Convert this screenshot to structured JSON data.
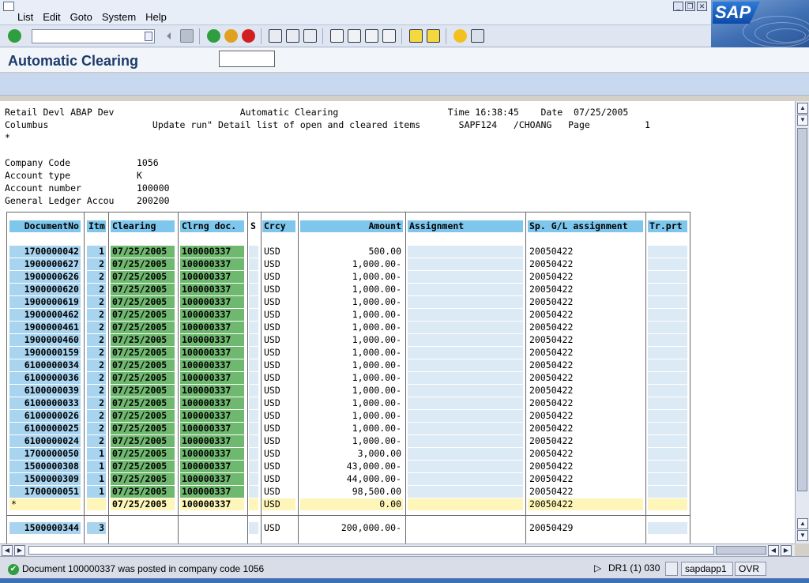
{
  "menu": {
    "items": [
      "List",
      "Edit",
      "Goto",
      "System",
      "Help"
    ]
  },
  "logo": {
    "text": "SAP"
  },
  "toolbar": {
    "command_field_value": ""
  },
  "title": "Automatic Clearing",
  "header": {
    "lines": [
      "Retail Devl ABAP Dev                       Automatic Clearing                    Time 16:38:45    Date  07/25/2005",
      "Columbus                   Update run\" Detail list of open and cleared items       SAPF124   /CHOANG   Page          1",
      "*"
    ],
    "fields": [
      {
        "label": "Company Code",
        "value": "1056"
      },
      {
        "label": "Account type",
        "value": "K"
      },
      {
        "label": "Account number",
        "value": "100000"
      },
      {
        "label": "General Ledger Accou",
        "value": "200200"
      }
    ]
  },
  "table": {
    "columns": [
      "DocumentNo",
      "Itm",
      "Clearing",
      "Clrng doc.",
      "S",
      "Crcy",
      "Amount",
      "Assignment",
      "Sp. G/L assignment",
      "Tr.prt"
    ],
    "rows": [
      {
        "doc": "1700000042",
        "itm": "1",
        "clearing": "07/25/2005",
        "clrng_doc": "100000337",
        "crcy": "USD",
        "amount": "500.00",
        "sp_gl": "20050422"
      },
      {
        "doc": "1900000627",
        "itm": "2",
        "clearing": "07/25/2005",
        "clrng_doc": "100000337",
        "crcy": "USD",
        "amount": "1,000.00-",
        "sp_gl": "20050422"
      },
      {
        "doc": "1900000626",
        "itm": "2",
        "clearing": "07/25/2005",
        "clrng_doc": "100000337",
        "crcy": "USD",
        "amount": "1,000.00-",
        "sp_gl": "20050422"
      },
      {
        "doc": "1900000620",
        "itm": "2",
        "clearing": "07/25/2005",
        "clrng_doc": "100000337",
        "crcy": "USD",
        "amount": "1,000.00-",
        "sp_gl": "20050422"
      },
      {
        "doc": "1900000619",
        "itm": "2",
        "clearing": "07/25/2005",
        "clrng_doc": "100000337",
        "crcy": "USD",
        "amount": "1,000.00-",
        "sp_gl": "20050422"
      },
      {
        "doc": "1900000462",
        "itm": "2",
        "clearing": "07/25/2005",
        "clrng_doc": "100000337",
        "crcy": "USD",
        "amount": "1,000.00-",
        "sp_gl": "20050422"
      },
      {
        "doc": "1900000461",
        "itm": "2",
        "clearing": "07/25/2005",
        "clrng_doc": "100000337",
        "crcy": "USD",
        "amount": "1,000.00-",
        "sp_gl": "20050422"
      },
      {
        "doc": "1900000460",
        "itm": "2",
        "clearing": "07/25/2005",
        "clrng_doc": "100000337",
        "crcy": "USD",
        "amount": "1,000.00-",
        "sp_gl": "20050422"
      },
      {
        "doc": "1900000159",
        "itm": "2",
        "clearing": "07/25/2005",
        "clrng_doc": "100000337",
        "crcy": "USD",
        "amount": "1,000.00-",
        "sp_gl": "20050422"
      },
      {
        "doc": "6100000034",
        "itm": "2",
        "clearing": "07/25/2005",
        "clrng_doc": "100000337",
        "crcy": "USD",
        "amount": "1,000.00-",
        "sp_gl": "20050422"
      },
      {
        "doc": "6100000036",
        "itm": "2",
        "clearing": "07/25/2005",
        "clrng_doc": "100000337",
        "crcy": "USD",
        "amount": "1,000.00-",
        "sp_gl": "20050422"
      },
      {
        "doc": "6100000039",
        "itm": "2",
        "clearing": "07/25/2005",
        "clrng_doc": "100000337",
        "crcy": "USD",
        "amount": "1,000.00-",
        "sp_gl": "20050422"
      },
      {
        "doc": "6100000033",
        "itm": "2",
        "clearing": "07/25/2005",
        "clrng_doc": "100000337",
        "crcy": "USD",
        "amount": "1,000.00-",
        "sp_gl": "20050422"
      },
      {
        "doc": "6100000026",
        "itm": "2",
        "clearing": "07/25/2005",
        "clrng_doc": "100000337",
        "crcy": "USD",
        "amount": "1,000.00-",
        "sp_gl": "20050422"
      },
      {
        "doc": "6100000025",
        "itm": "2",
        "clearing": "07/25/2005",
        "clrng_doc": "100000337",
        "crcy": "USD",
        "amount": "1,000.00-",
        "sp_gl": "20050422"
      },
      {
        "doc": "6100000024",
        "itm": "2",
        "clearing": "07/25/2005",
        "clrng_doc": "100000337",
        "crcy": "USD",
        "amount": "1,000.00-",
        "sp_gl": "20050422"
      },
      {
        "doc": "1700000050",
        "itm": "1",
        "clearing": "07/25/2005",
        "clrng_doc": "100000337",
        "crcy": "USD",
        "amount": "3,000.00",
        "sp_gl": "20050422"
      },
      {
        "doc": "1500000308",
        "itm": "1",
        "clearing": "07/25/2005",
        "clrng_doc": "100000337",
        "crcy": "USD",
        "amount": "43,000.00-",
        "sp_gl": "20050422"
      },
      {
        "doc": "1500000309",
        "itm": "1",
        "clearing": "07/25/2005",
        "clrng_doc": "100000337",
        "crcy": "USD",
        "amount": "44,000.00-",
        "sp_gl": "20050422"
      },
      {
        "doc": "1700000051",
        "itm": "1",
        "clearing": "07/25/2005",
        "clrng_doc": "100000337",
        "crcy": "USD",
        "amount": "98,500.00",
        "sp_gl": "20050422"
      }
    ],
    "total": {
      "doc": "*",
      "clearing": "07/25/2005",
      "clrng_doc": "100000337",
      "crcy": "USD",
      "amount": "0.00",
      "sp_gl": "20050422"
    },
    "next": {
      "doc": "1500000344",
      "itm": "3",
      "crcy": "USD",
      "amount": "200,000.00-",
      "sp_gl": "20050429"
    }
  },
  "status": {
    "message": "Document 100000337 was posted in company code 1056",
    "system": "DR1 (1) 030",
    "server": "sapdapp1",
    "mode": "OVR"
  },
  "colors": {
    "header_cell": "#7ec6ec",
    "key_cell": "#a8d4f0",
    "cleared_cell": "#6fb86f",
    "total_row": "#fdf6b8",
    "title_text": "#1c3a6a"
  }
}
